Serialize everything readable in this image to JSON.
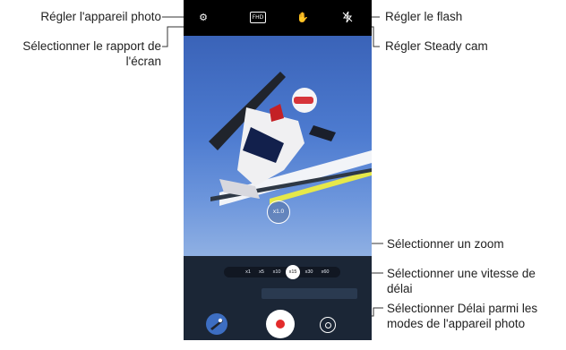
{
  "callouts": {
    "camera_settings": "Régler l'appareil photo",
    "aspect_ratio": "Sélectionner le rapport de l'écran",
    "flash": "Régler le flash",
    "steady_cam": "Régler Steady cam",
    "zoom": "Sélectionner un zoom",
    "speed": "Sélectionner une vitesse de délai",
    "timelapse_mode": "Sélectionner Délai parmi les modes de l'appareil photo"
  },
  "camera": {
    "resolution_badge": "FHD",
    "zoom_level": "x1.0",
    "speed_options": [
      "x1",
      "x5",
      "x10",
      "x15",
      "x30",
      "x60"
    ],
    "selected_speed": "x15",
    "icons": {
      "settings": "gear-icon",
      "steady_cam": "hand-shake-icon",
      "flash": "flash-off-icon",
      "record": "record-icon",
      "switch": "camera-switch-icon"
    }
  }
}
